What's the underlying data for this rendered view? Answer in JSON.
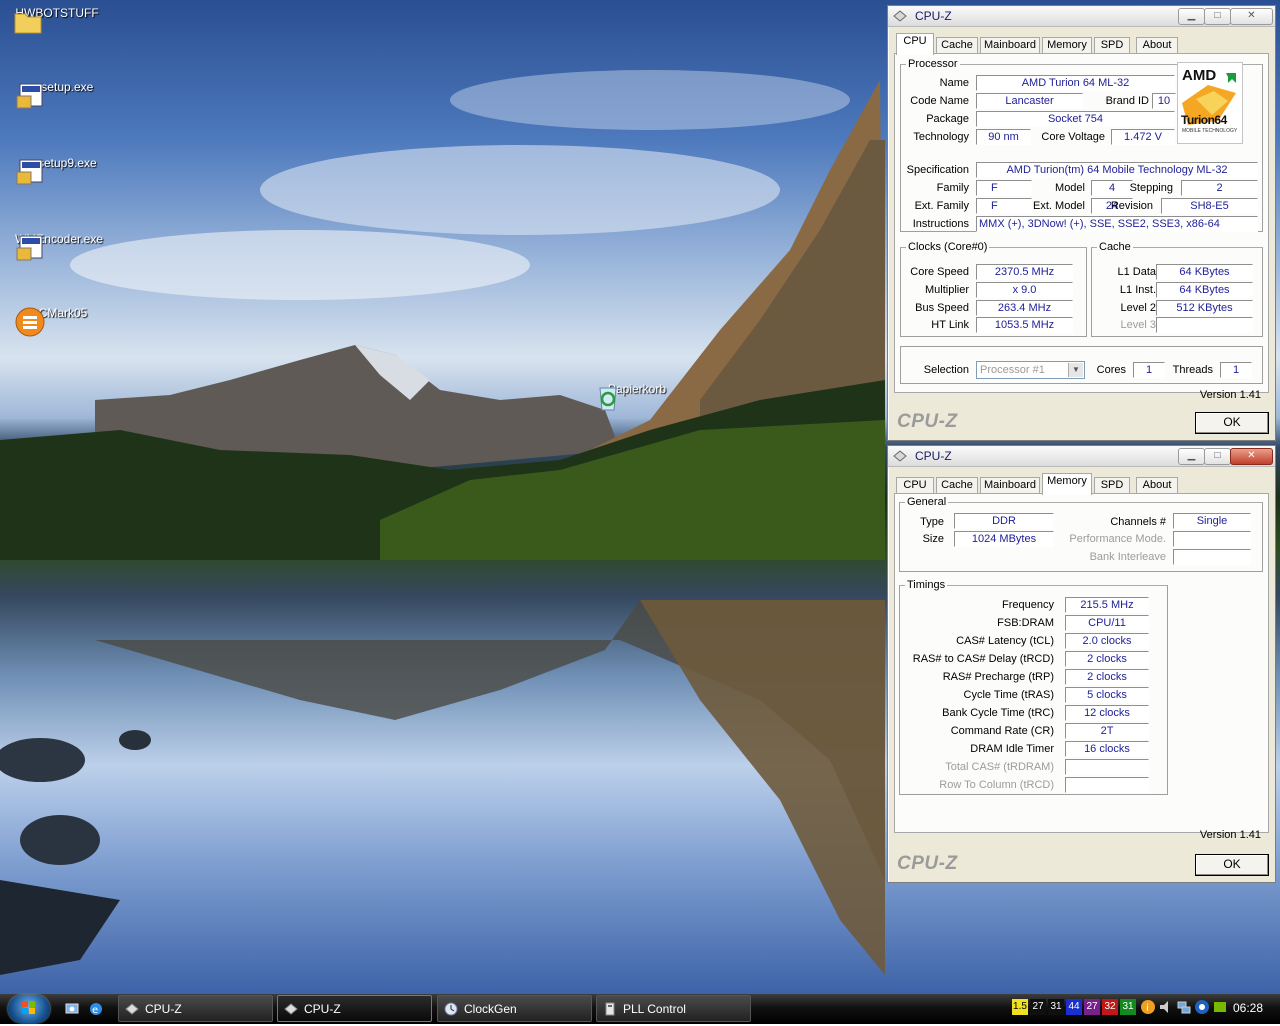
{
  "desktop": {
    "icons": [
      {
        "label": "HWBOTSTUFF"
      },
      {
        "label": "mpsetup.exe"
      },
      {
        "label": "mpsetup9.exe"
      },
      {
        "label": "WMEncoder.exe"
      },
      {
        "label": "PCMark05"
      },
      {
        "label": "Papierkorb"
      }
    ]
  },
  "cpuz_common": {
    "title": "CPU-Z",
    "tabs": [
      "CPU",
      "Cache",
      "Mainboard",
      "Memory",
      "SPD",
      "About"
    ],
    "version": "Version 1.41",
    "brand": "CPU-Z",
    "ok": "OK"
  },
  "cpu_window": {
    "active_tab": "CPU",
    "processor": {
      "legend": "Processor",
      "name_label": "Name",
      "name": "AMD Turion 64 ML-32",
      "codename_label": "Code Name",
      "codename": "Lancaster",
      "brandid_label": "Brand ID",
      "brandid": "10",
      "package_label": "Package",
      "package": "Socket 754",
      "technology_label": "Technology",
      "technology": "90 nm",
      "voltage_label": "Core Voltage",
      "voltage": "1.472 V",
      "spec_label": "Specification",
      "spec": "AMD Turion(tm) 64 Mobile Technology ML-32",
      "family_label": "Family",
      "family": "F",
      "model_label": "Model",
      "model": "4",
      "stepping_label": "Stepping",
      "stepping": "2",
      "extfamily_label": "Ext. Family",
      "extfamily": "F",
      "extmodel_label": "Ext. Model",
      "extmodel": "24",
      "revision_label": "Revision",
      "revision": "SH8-E5",
      "instructions_label": "Instructions",
      "instructions": "MMX (+), 3DNow! (+), SSE, SSE2, SSE3, x86-64",
      "logo_brand": "AMD",
      "logo_product": "Turion64",
      "logo_sub": "MOBILE TECHNOLOGY"
    },
    "clocks": {
      "legend": "Clocks (Core#0)",
      "core_speed_label": "Core Speed",
      "core_speed": "2370.5 MHz",
      "multiplier_label": "Multiplier",
      "multiplier": "x 9.0",
      "bus_speed_label": "Bus Speed",
      "bus_speed": "263.4 MHz",
      "ht_link_label": "HT Link",
      "ht_link": "1053.5 MHz"
    },
    "cache": {
      "legend": "Cache",
      "l1d_label": "L1 Data",
      "l1d": "64 KBytes",
      "l1i_label": "L1 Inst.",
      "l1i": "64 KBytes",
      "l2_label": "Level 2",
      "l2": "512 KBytes",
      "l3_label": "Level 3",
      "l3": ""
    },
    "selection": {
      "label": "Selection",
      "value": "Processor #1",
      "cores_label": "Cores",
      "cores": "1",
      "threads_label": "Threads",
      "threads": "1"
    }
  },
  "mem_window": {
    "active_tab": "Memory",
    "general": {
      "legend": "General",
      "type_label": "Type",
      "type": "DDR",
      "size_label": "Size",
      "size": "1024 MBytes",
      "channels_label": "Channels #",
      "channels": "Single",
      "perf_label": "Performance Mode.",
      "perf": "",
      "bank_label": "Bank Interleave",
      "bank": ""
    },
    "timings": {
      "legend": "Timings",
      "rows": [
        {
          "label": "Frequency",
          "value": "215.5 MHz",
          "disabled": false
        },
        {
          "label": "FSB:DRAM",
          "value": "CPU/11",
          "disabled": false
        },
        {
          "label": "CAS# Latency (tCL)",
          "value": "2.0 clocks",
          "disabled": false
        },
        {
          "label": "RAS# to CAS# Delay (tRCD)",
          "value": "2 clocks",
          "disabled": false
        },
        {
          "label": "RAS# Precharge (tRP)",
          "value": "2 clocks",
          "disabled": false
        },
        {
          "label": "Cycle Time (tRAS)",
          "value": "5 clocks",
          "disabled": false
        },
        {
          "label": "Bank Cycle Time (tRC)",
          "value": "12 clocks",
          "disabled": false
        },
        {
          "label": "Command Rate (CR)",
          "value": "2T",
          "disabled": false
        },
        {
          "label": "DRAM Idle Timer",
          "value": "16 clocks",
          "disabled": false
        },
        {
          "label": "Total CAS# (tRDRAM)",
          "value": "",
          "disabled": true
        },
        {
          "label": "Row To Column (tRCD)",
          "value": "",
          "disabled": true
        }
      ]
    }
  },
  "taskbar": {
    "buttons": [
      {
        "label": "CPU-Z"
      },
      {
        "label": "CPU-Z"
      },
      {
        "label": "ClockGen"
      },
      {
        "label": "PLL Control"
      }
    ],
    "tray_numbers": [
      {
        "text": "1.5",
        "bg": "#f0e020",
        "fg": "#000"
      },
      {
        "text": "27",
        "bg": "#101010",
        "fg": "#fff"
      },
      {
        "text": "31",
        "bg": "#101010",
        "fg": "#fff"
      },
      {
        "text": "44",
        "bg": "#1b2fd0",
        "fg": "#fff"
      },
      {
        "text": "27",
        "bg": "#7a1f8e",
        "fg": "#fff"
      },
      {
        "text": "32",
        "bg": "#c01818",
        "fg": "#fff"
      },
      {
        "text": "31",
        "bg": "#128a1e",
        "fg": "#fff"
      }
    ],
    "clock": "06:28"
  }
}
